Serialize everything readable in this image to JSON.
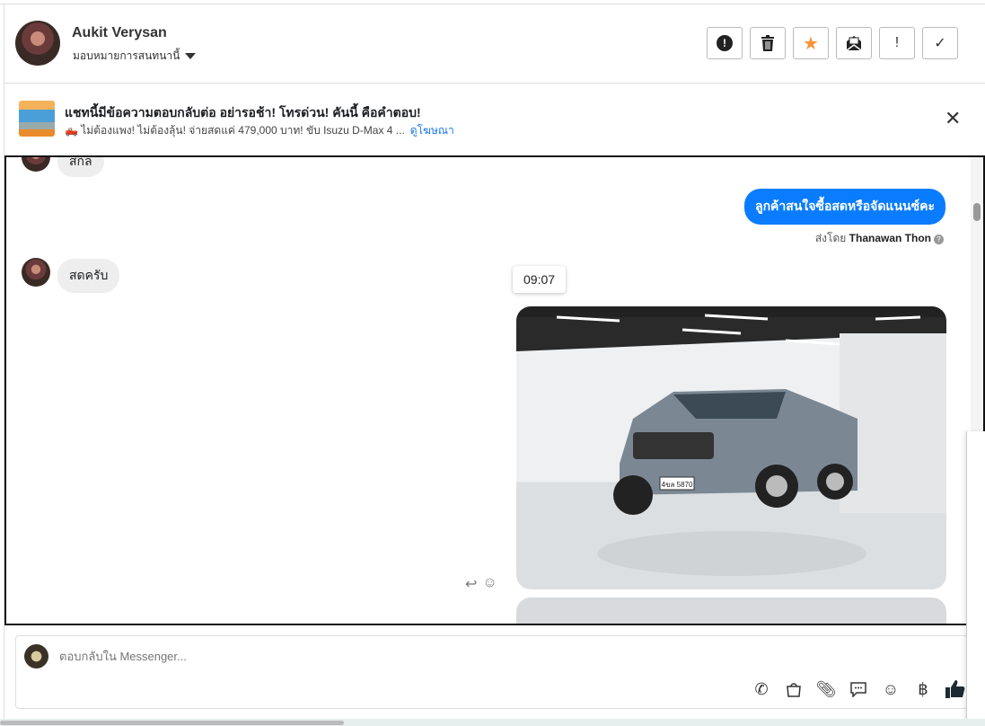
{
  "header": {
    "name": "Aukit Verysan",
    "assign_label": "มอบหมายการสนทนานี้",
    "actions": [
      {
        "name": "spam",
        "glyph": "!"
      },
      {
        "name": "delete",
        "glyph": "🗑"
      },
      {
        "name": "star",
        "glyph": "★"
      },
      {
        "name": "mark-unread",
        "glyph": "✉"
      },
      {
        "name": "important",
        "glyph": "!"
      },
      {
        "name": "done",
        "glyph": "✓"
      }
    ]
  },
  "ad": {
    "title": "แชทนี้มีข้อความตอบกลับต่อ อย่ารอช้า! โทรด่วน! คันนี้ คือคำตอบ!",
    "subtitle": "🛻 ไม่ต้องแพง! ไม่ต้องลุ้น! จ่ายสดแค่ 479,000 บาท! ขับ Isuzu D-Max 4 ...",
    "link": "ดูโฆษณา",
    "close": "✕"
  },
  "messages": {
    "m1": "สกล",
    "m2": "ลูกค้าสนใจซื้อสดหรือจัดแนนซ์คะ",
    "sent_by_prefix": "ส่งโดย",
    "sent_by": "Thanawan Thon",
    "m3": "สดครับ",
    "time": "09:07",
    "plate": "4ขล 5870"
  },
  "composer": {
    "placeholder": "ตอบกลับใน Messenger...",
    "baht": "฿"
  },
  "colors": {
    "accent": "#0a7cff",
    "star": "#f7923a"
  }
}
